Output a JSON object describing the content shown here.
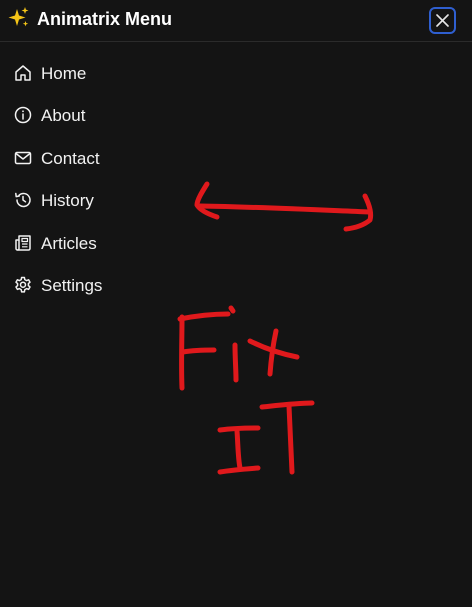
{
  "header": {
    "title": "Animatrix Menu",
    "title_icon": "sparkles-icon",
    "close_icon": "close-icon",
    "accent_color": "#2f5fd0"
  },
  "nav": {
    "items": [
      {
        "label": "Home",
        "icon": "home-icon"
      },
      {
        "label": "About",
        "icon": "info-icon"
      },
      {
        "label": "Contact",
        "icon": "mail-icon"
      },
      {
        "label": "History",
        "icon": "history-icon"
      },
      {
        "label": "Articles",
        "icon": "newspaper-icon"
      },
      {
        "label": "Settings",
        "icon": "gear-icon"
      }
    ]
  },
  "annotation": {
    "color": "#e0191c",
    "text_line1": "Fix",
    "text_line2": "IT"
  }
}
